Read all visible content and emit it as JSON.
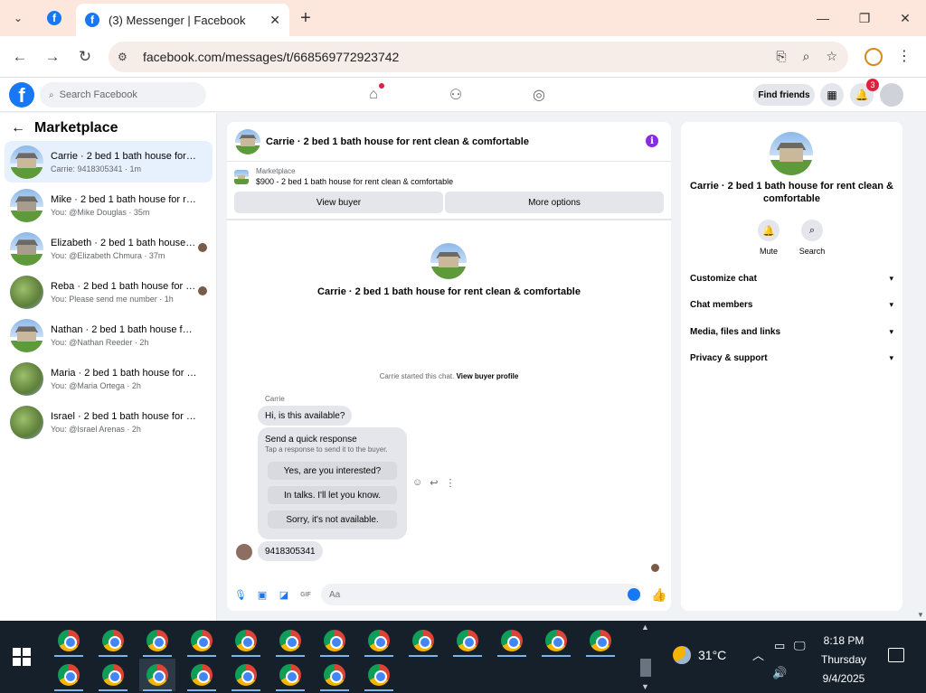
{
  "browser": {
    "tab_title": "(3) Messenger | Facebook",
    "url": "facebook.com/messages/t/668569772923742"
  },
  "fb": {
    "search_placeholder": "Search Facebook",
    "find_friends": "Find friends",
    "notifications_count": "3",
    "colors": {
      "brand": "#1877f2",
      "badge": "#e41e3f",
      "info": "#8a2be2"
    }
  },
  "sidebar": {
    "title": "Marketplace",
    "conversations": [
      {
        "title": "Carrie · 2 bed 1 bath house for ren...",
        "subtitle": "Carrie: 9418305341 · 1m",
        "active": true,
        "thumb": "house"
      },
      {
        "title": "Mike · 2 bed 1 bath house for rent ...",
        "subtitle": "You: @Mike Douglas · 35m",
        "thumb": "house2"
      },
      {
        "title": "Elizabeth · 2 bed 1 bath house f...",
        "subtitle": "You: @Elizabeth Chmura · 37m",
        "thumb": "house2",
        "read": true
      },
      {
        "title": "Reba · 2 bed 1 bath house for re...",
        "subtitle": "You: Please send me number · 1h",
        "thumb": "tree",
        "read": true
      },
      {
        "title": "Nathan · 2 bed 1 bath house for re...",
        "subtitle": "You: @Nathan Reeder · 2h",
        "thumb": "house"
      },
      {
        "title": "Maria · 2 bed 1 bath house for rent...",
        "subtitle": "You: @Maria Ortega · 2h",
        "thumb": "tree"
      },
      {
        "title": "Israel · 2 bed 1 bath house for rent...",
        "subtitle": "You: @Israel Arenas · 2h",
        "thumb": "tree"
      }
    ]
  },
  "chat": {
    "title": "Carrie · 2 bed 1 bath house for rent clean & comfortable",
    "marketplace_label": "Marketplace",
    "listing": "$900 - 2 bed 1 bath house for rent clean & comfortable",
    "view_buyer": "View buyer",
    "more_options": "More options",
    "started_text": "Carrie started this chat.",
    "view_buyer_profile": "View buyer profile",
    "sender": "Carrie",
    "message_1": "Hi, is this available?",
    "quick_title": "Send a quick response",
    "quick_sub": "Tap a response to send it to the buyer.",
    "quick_replies": [
      "Yes, are you interested?",
      "In talks. I'll let you know.",
      "Sorry, it's not available."
    ],
    "message_2": "9418305341",
    "composer_placeholder": "Aa"
  },
  "details": {
    "name": "Carrie · 2 bed 1 bath house for rent clean & comfortable",
    "mute": "Mute",
    "search": "Search",
    "sections": [
      "Customize chat",
      "Chat members",
      "Media, files and links",
      "Privacy & support"
    ]
  },
  "taskbar": {
    "temperature": "31°C",
    "time": "8:18 PM",
    "day": "Thursday",
    "date": "9/4/2025"
  }
}
